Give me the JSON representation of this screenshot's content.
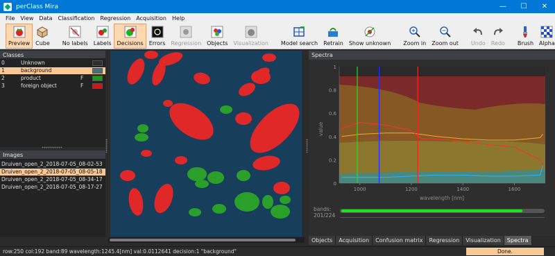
{
  "window": {
    "title": "perClass Mira",
    "minimize": "—",
    "maximize": "☐",
    "close": "✕"
  },
  "menu": [
    "File",
    "View",
    "Data",
    "Classification",
    "Regression",
    "Acquisition",
    "Help"
  ],
  "toolbar": {
    "preview": "Preview",
    "cube": "Cube",
    "no_labels": "No labels",
    "labels": "Labels",
    "decisions": "Decisions",
    "errors": "Errors",
    "regression": "Regression",
    "objects": "Objects",
    "visualization": "Visualization",
    "model_search": "Model search",
    "retrain": "Retrain",
    "show_unknown": "Show unknown",
    "zoom_in": "Zoom in",
    "zoom_out": "Zoom out",
    "undo": "Undo",
    "redo": "Redo",
    "brush": "Brush",
    "alpha": "Alpha",
    "more": "»"
  },
  "classes": {
    "title": "Classes",
    "rows": [
      {
        "id": "0",
        "name": "Unknown",
        "flag": "",
        "color": "#2e2e2e"
      },
      {
        "id": "1",
        "name": "background",
        "flag": "",
        "color": "#4a6e7d"
      },
      {
        "id": "2",
        "name": "product",
        "flag": "F",
        "color": "#1d9a1d"
      },
      {
        "id": "3",
        "name": "foreign object",
        "flag": "F",
        "color": "#d21414"
      }
    ],
    "selected_index": 1
  },
  "images": {
    "title": "Images",
    "rows": [
      "Druiven_open_2_2018-07-05_08-02-53",
      "Druiven_open_2_2018-07-05_08-05-18",
      "Druiven_open_2_2018-07-05_08-34-17",
      "Druiven_open_2_2018-07-05_08-17-27"
    ],
    "selected_index": 1
  },
  "spectra": {
    "title": "Spectra",
    "ylabel": "value",
    "xlabel": "wavelength [nm]",
    "x_ticks": [
      "1000",
      "1200",
      "1400",
      "1600"
    ],
    "y_ticks": [
      "0",
      "0.2",
      "0.4",
      "0.6",
      "0.8",
      "1"
    ],
    "bands_label_1": "bands:",
    "bands_label_2": "201/224",
    "bands_fraction": 0.897,
    "colors": {
      "red": "#ff2020",
      "green": "#20c020",
      "blue": "#2030ff",
      "olive": "#9aa020"
    }
  },
  "chart_data": {
    "type": "line",
    "xlabel": "wavelength [nm]",
    "ylabel": "value",
    "xlim": [
      920,
      1720
    ],
    "ylim": [
      0,
      1
    ],
    "markers": [
      {
        "x": 990,
        "color": "#20e020"
      },
      {
        "x": 1075,
        "color": "#2030ff"
      },
      {
        "x": 1225,
        "color": "#ff2020"
      }
    ],
    "series": [
      {
        "x": [
          930,
          1000,
          1100,
          1200,
          1300,
          1400,
          1500,
          1600,
          1700,
          1710
        ],
        "values": [
          0.4,
          0.42,
          0.43,
          0.43,
          0.4,
          0.38,
          0.37,
          0.37,
          0.39,
          0.42
        ]
      },
      {
        "x": [
          930,
          1000,
          1100,
          1200,
          1240,
          1300,
          1400,
          1500,
          1600,
          1700,
          1710
        ],
        "values": [
          0.47,
          0.52,
          0.5,
          0.45,
          0.38,
          0.38,
          0.36,
          0.33,
          0.31,
          0.2,
          0.16
        ]
      },
      {
        "x": [
          930,
          1000,
          1100,
          1200,
          1300,
          1400,
          1500,
          1600,
          1700,
          1710
        ],
        "values": [
          0.05,
          0.05,
          0.05,
          0.06,
          0.07,
          0.07,
          0.06,
          0.06,
          0.07,
          0.15
        ]
      }
    ]
  },
  "tabs": [
    "Objects",
    "Acquisition",
    "Confusion matrix",
    "Regression",
    "Visualization",
    "Spectra"
  ],
  "active_tab": 5,
  "status": {
    "text": "row:250 col:192 band:89 wavelength:1245.4[nm] val:0.0112641 decision:1 \"background\"",
    "done": "Done."
  }
}
